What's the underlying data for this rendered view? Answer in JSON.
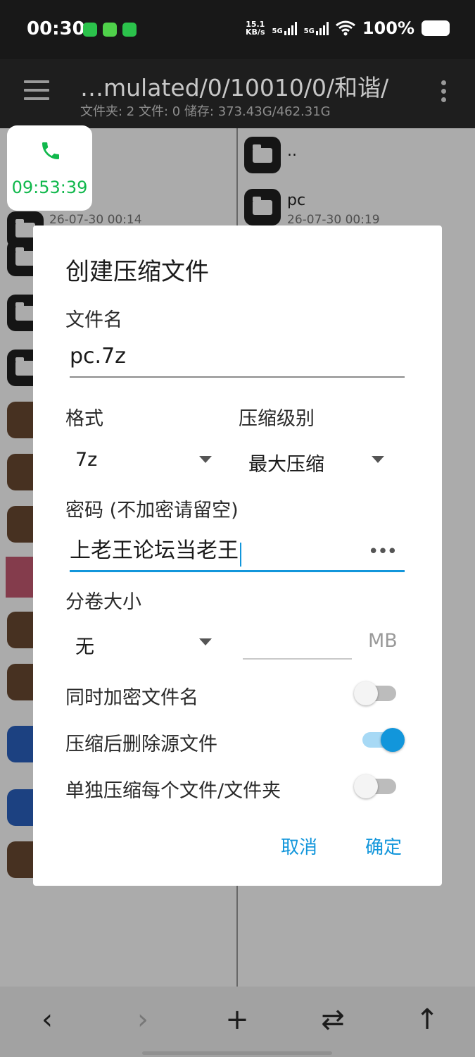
{
  "status_bar": {
    "time": "00:30",
    "net_speed_value": "15.1",
    "net_speed_unit": "KB/s",
    "sim1": "5G",
    "sim2": "5G",
    "battery": "100%"
  },
  "toolbar": {
    "path": "…mulated/0/10010/0/和谐/",
    "info": "文件夹: 2  文件: 0  储存: 373.43G/462.31G"
  },
  "left_pane": {
    "first_date": "26-07-30 00:14"
  },
  "right_pane": {
    "items": [
      {
        "name": "..",
        "date": ""
      },
      {
        "name": "pc",
        "date": "26-07-30 00:19"
      }
    ]
  },
  "call_widget": {
    "timer": "09:53:39"
  },
  "dialog": {
    "title": "创建压缩文件",
    "filename_label": "文件名",
    "filename_value": "pc.7z",
    "format_label": "格式",
    "format_value": "7z",
    "level_label": "压缩级别",
    "level_value": "最大压缩",
    "password_label": "密码 (不加密请留空)",
    "password_value": "上老王论坛当老王",
    "password_toggle": "•••",
    "volume_label": "分卷大小",
    "volume_value": "无",
    "volume_unit": "MB",
    "switches": [
      {
        "label": "同时加密文件名",
        "on": false
      },
      {
        "label": "压缩后删除源文件",
        "on": true
      },
      {
        "label": "单独压缩每个文件/文件夹",
        "on": false
      }
    ],
    "cancel": "取消",
    "confirm": "确定"
  },
  "bottom_bar": {
    "back": "‹",
    "forward": "›",
    "add": "+",
    "swap": "⇄",
    "up": "↑"
  },
  "colors": {
    "accent": "#1296db",
    "call_green": "#11b84c"
  }
}
